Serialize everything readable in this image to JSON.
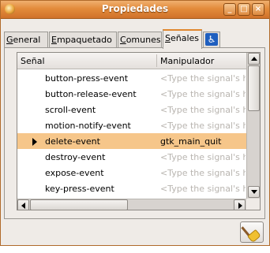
{
  "window": {
    "title": "Propiedades"
  },
  "tabs": [
    {
      "mnemonic": "G",
      "rest": "eneral"
    },
    {
      "mnemonic": "E",
      "rest": "mpaquetado"
    },
    {
      "mnemonic": "C",
      "rest": "omunes"
    },
    {
      "mnemonic": "S",
      "rest": "eñales"
    }
  ],
  "list": {
    "columns": [
      "Señal",
      "Manipulador"
    ],
    "placeholder": "<Type the signal's handler here>",
    "rows": [
      {
        "signal": "button-press-event",
        "handler": ""
      },
      {
        "signal": "button-release-event",
        "handler": ""
      },
      {
        "signal": "scroll-event",
        "handler": ""
      },
      {
        "signal": "motion-notify-event",
        "handler": ""
      },
      {
        "signal": "delete-event",
        "handler": "gtk_main_quit",
        "selected": true
      },
      {
        "signal": "destroy-event",
        "handler": ""
      },
      {
        "signal": "expose-event",
        "handler": ""
      },
      {
        "signal": "key-press-event",
        "handler": ""
      }
    ]
  },
  "colors": {
    "titlebar": "#e38b3b",
    "selection": "#f6c68a",
    "active_tab_accent": "#e0872f"
  }
}
